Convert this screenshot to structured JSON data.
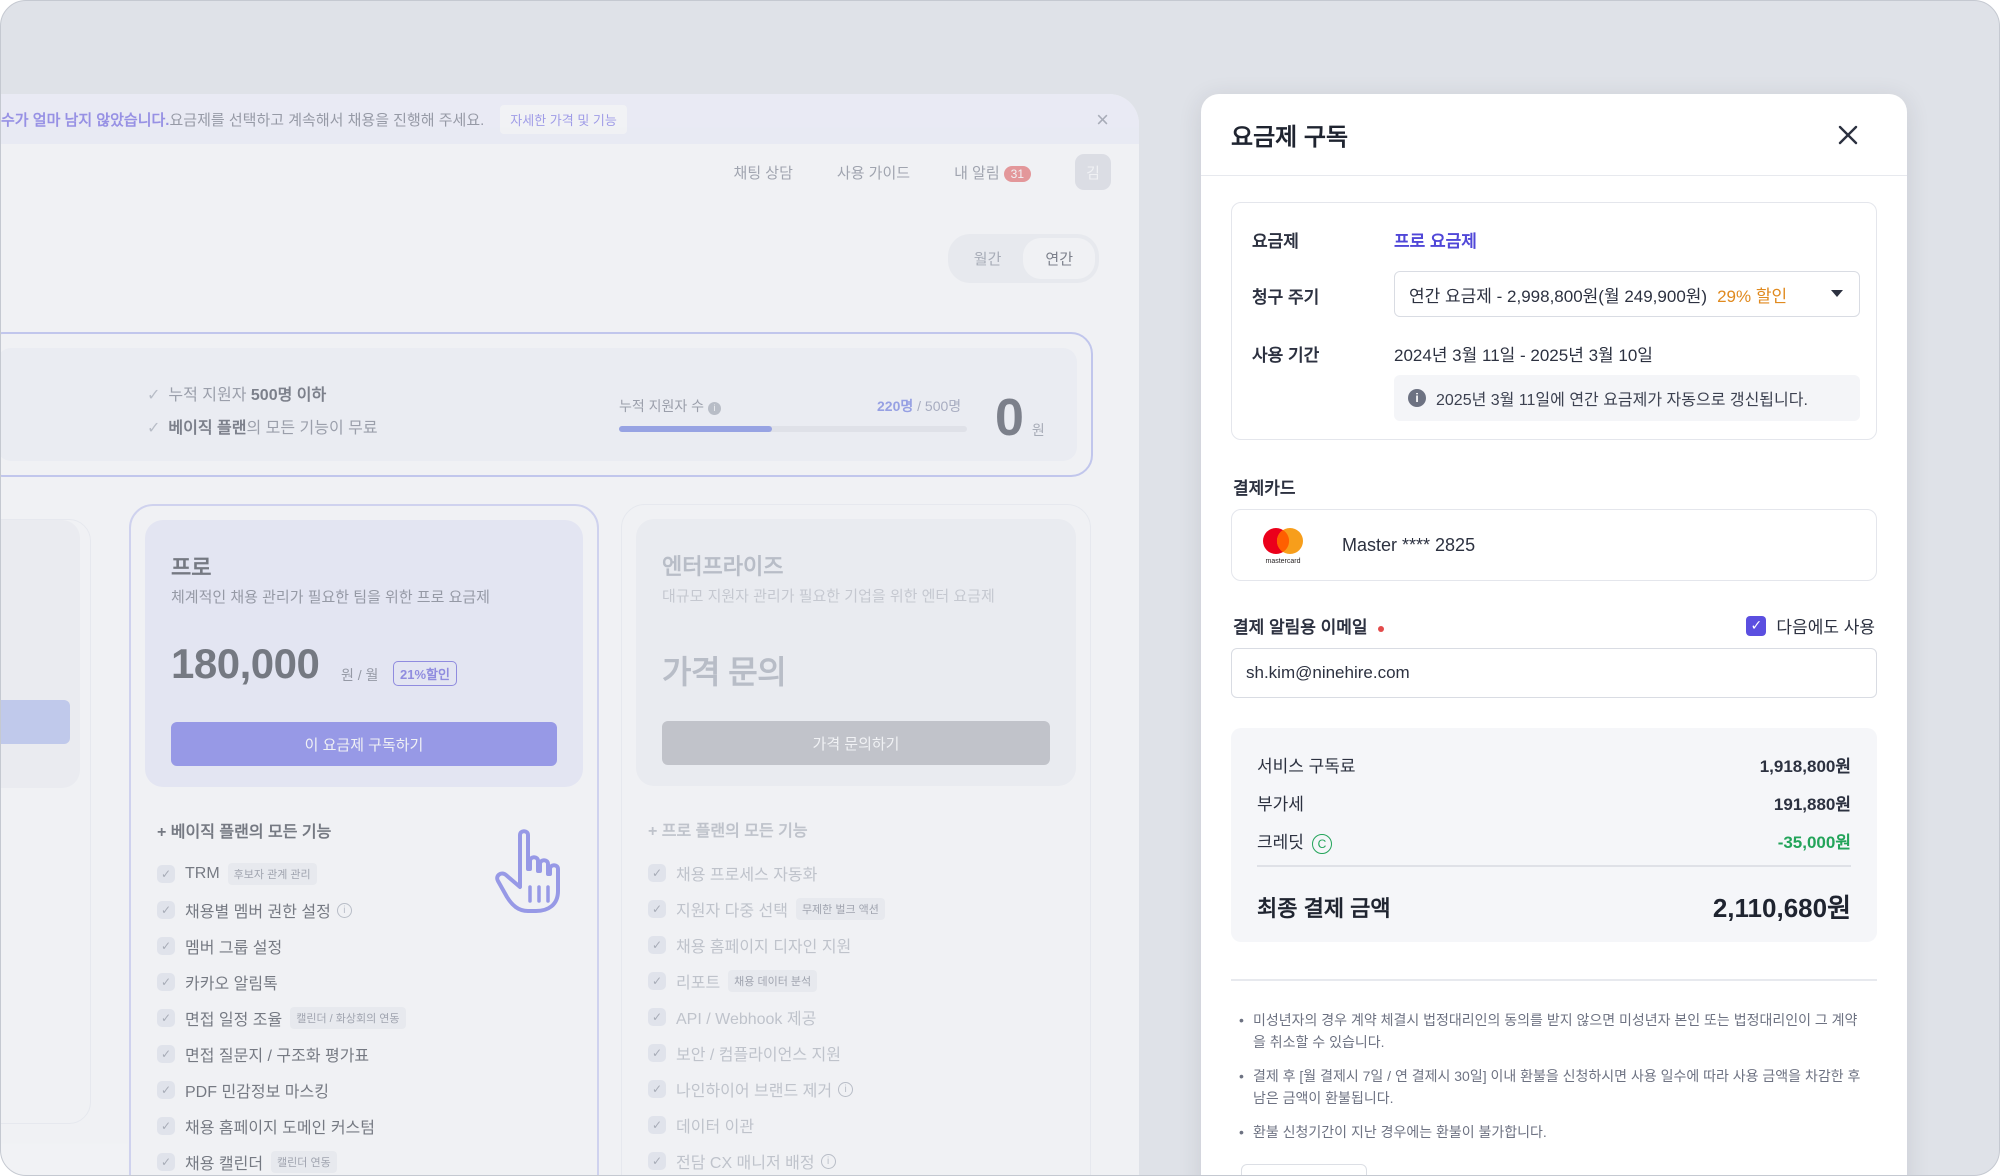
{
  "banner": {
    "bold_text": "수가 얼마 남지 않았습니다.",
    "text": " 요금제를 선택하고 계속해서 채용을 진행해 주세요.",
    "link": "자세한 가격 및 기능",
    "close": "×"
  },
  "topnav": {
    "chat": "채팅 상담",
    "guide": "사용 가이드",
    "alerts": "내 알림",
    "alert_count": "31",
    "avatar": "김"
  },
  "period_toggle": {
    "monthly": "월간",
    "yearly": "연간",
    "selected": "yearly"
  },
  "usage": {
    "check1_pre": "누적 지원자 ",
    "check1_bold": "500명 이하",
    "check2_bold": "베이직 플랜",
    "check2_post": "의 모든 기능이 무료",
    "meter_label": "누적 지원자 수",
    "meter_current": "220명",
    "meter_total": " / 500명",
    "meter_progress": 0.44,
    "amount": "0",
    "amount_unit": "원"
  },
  "plans": {
    "pro": {
      "title": "프로",
      "desc": "체계적인 채용 관리가 필요한 팀을 위한 프로 요금제",
      "price": "180,000",
      "unit": "원 / 월",
      "discount": "21%할인",
      "cta": "이 요금제 구독하기",
      "features_title": "+ 베이직 플랜의 모든 기능",
      "features": [
        {
          "label": "TRM",
          "tag": "후보자 관계 관리"
        },
        {
          "label": "채용별 멤버 권한 설정",
          "info": true
        },
        {
          "label": "멤버 그룹 설정"
        },
        {
          "label": "카카오 알림톡"
        },
        {
          "label": "면접 일정 조율",
          "tag": "캘린더 / 화상회의 연동"
        },
        {
          "label": "면접 질문지 / 구조화 평가표"
        },
        {
          "label": "PDF 민감정보 마스킹"
        },
        {
          "label": "채용 홈페이지 도메인 커스텀"
        },
        {
          "label": "채용 캘린더",
          "tag": "캘린더 연동"
        }
      ]
    },
    "enterprise": {
      "title": "엔터프라이즈",
      "desc": "대규모 지원자 관리가 필요한 기업을 위한 엔터 요금제",
      "price": "가격 문의",
      "cta": "가격 문의하기",
      "features_title": "+ 프로 플랜의 모든 기능",
      "features": [
        {
          "label": "채용 프로세스 자동화"
        },
        {
          "label": "지원자 다중 선택",
          "tag": "무제한 벌크 액션"
        },
        {
          "label": "채용 홈페이지 디자인 지원"
        },
        {
          "label": "리포트",
          "tag": "채용 데이터 분석"
        },
        {
          "label": "API / Webhook 제공"
        },
        {
          "label": "보안 / 컴플라이언스 지원"
        },
        {
          "label": "나인하이어 브랜드 제거",
          "info": true
        },
        {
          "label": "데이터 이관"
        },
        {
          "label": "전담 CX 매니저 배정",
          "info": true
        }
      ]
    }
  },
  "modal": {
    "title": "요금제 구독",
    "plan_label": "요금제",
    "plan_value": "프로 요금제",
    "billing_label": "청구 주기",
    "billing_value": "연간 요금제 - 2,998,800원(월 249,900원)",
    "billing_discount": "29% 할인",
    "period_label": "사용 기간",
    "period_value": "2024년 3월 11일 - 2025년 3월 10일",
    "renew_notice": "2025년 3월 11일에 연간 요금제가 자동으로 갱신됩니다.",
    "card_section": "결제카드",
    "card_brand_text": "mastercard",
    "card_value": "Master **** 2825",
    "email_section": "결제 알림용 이메일",
    "reuse_label": "다음에도 사용",
    "reuse_checked": true,
    "email_value": "sh.kim@ninehire.com",
    "summary": {
      "service_label": "서비스 구독료",
      "service_amount": "1,918,800원",
      "vat_label": "부가세",
      "vat_amount": "191,880원",
      "credit_label": "크레딧",
      "credit_amount": "-35,000원",
      "total_label": "최종 결제 금액",
      "total_amount": "2,110,680원"
    },
    "notes": [
      "미성년자의 경우 계약 체결시 법정대리인의 동의를 받지 않으면 미성년자 본인 또는 법정대리인이 그 계약을 취소할 수 있습니다.",
      "결제 후 [월 결제시 7일 / 연 결제시 30일] 이내 환불을 신청하시면 사용 일수에 따라 사용 금액을 차감한 후 남은 금액이 환불됩니다.",
      "환불 신청기간이 지난 경우에는 환불이 불가합니다."
    ]
  },
  "colors": {
    "accent": "#5b4fe0",
    "credit_green": "#23a45a",
    "discount_orange": "#e08a1f"
  }
}
